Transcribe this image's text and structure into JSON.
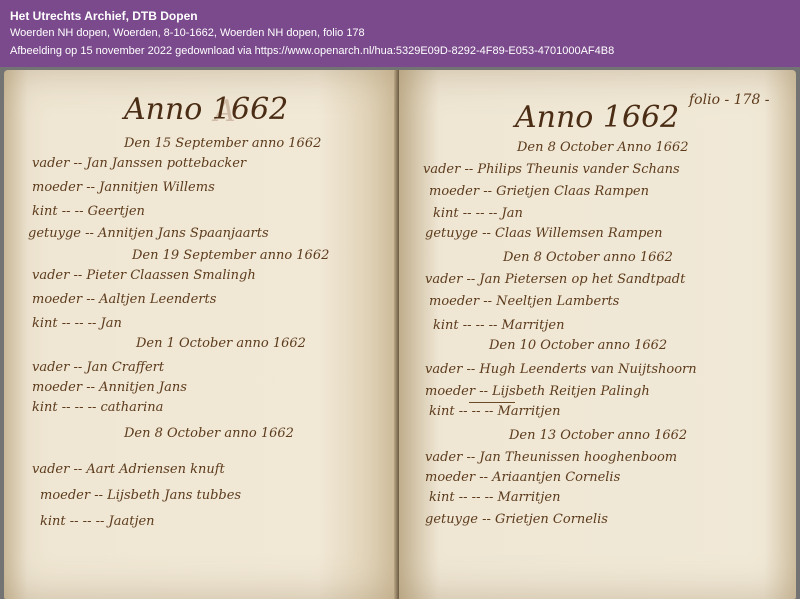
{
  "header": {
    "title": "Het Utrechts Archief, DTB Dopen",
    "subtitle": "Woerden NH dopen, Woerden, 8-10-1662, Woerden NH dopen, folio 178",
    "download": "Afbeelding op 15 november 2022 gedownload via https://www.openarch.nl/hua:5329E09D-8292-4F89-E053-4701000AF4B8"
  },
  "left_page": {
    "heading": "Anno 1662",
    "entries": [
      {
        "date": "Den 15 September anno 1662",
        "vader": "vader -- Jan Janssen pottebacker",
        "moeder": "moeder -- Jannitjen Willems",
        "kint": "kint -- -- Geertjen",
        "getuygen": "getuyge -- Annitjen Jans Spaanjaarts"
      },
      {
        "date": "Den 19 September anno 1662",
        "vader": "vader -- Pieter Claassen Smalingh",
        "moeder": "moeder -- Aaltjen Leenderts",
        "kint": "kint -- -- -- Jan"
      },
      {
        "date": "Den 1 October anno 1662",
        "vader": "vader -- Jan Craffert",
        "moeder": "moeder -- Annitjen Jans",
        "kint": "kint -- -- -- catharina"
      },
      {
        "date": "Den 8 October anno 1662",
        "vader": "vader -- Aart Adriensen knuft",
        "moeder": "moeder -- Lijsbeth Jans tubbes",
        "kint": "kint -- -- -- Jaatjen"
      }
    ]
  },
  "right_page": {
    "folio": "folio - 178 -",
    "heading": "Anno 1662",
    "entries": [
      {
        "date": "Den 8 October Anno 1662",
        "vader": "vader -- Philips Theunis vander Schans",
        "moeder": "moeder -- Grietjen Claas Rampen",
        "kint": "kint -- -- -- Jan",
        "getuygen": "getuyge -- Claas Willemsen Rampen"
      },
      {
        "date": "Den 8 October anno 1662",
        "vader": "vader -- Jan Pietersen op het Sandtpadt",
        "moeder": "moeder -- Neeltjen Lamberts",
        "kint": "kint -- -- -- Marritjen"
      },
      {
        "date": "Den 10 October anno 1662",
        "vader": "vader -- Hugh Leenderts van Nuijtshoorn",
        "moeder": "moeder -- Lijsbeth Reitjen Palingh",
        "kint": "kint -- -- -- Marritjen"
      },
      {
        "date": "Den 13 October anno 1662",
        "vader": "vader -- Jan Theunissen hooghenboom",
        "moeder": "moeder -- Ariaantjen Cornelis",
        "kint": "kint -- -- -- Marritjen",
        "getuygen": "getuyge -- Grietjen Cornelis"
      }
    ]
  },
  "colors": {
    "header_bg": "#7b4a8c",
    "ink": "#5c3b1c",
    "paper": "#efe5d1"
  }
}
